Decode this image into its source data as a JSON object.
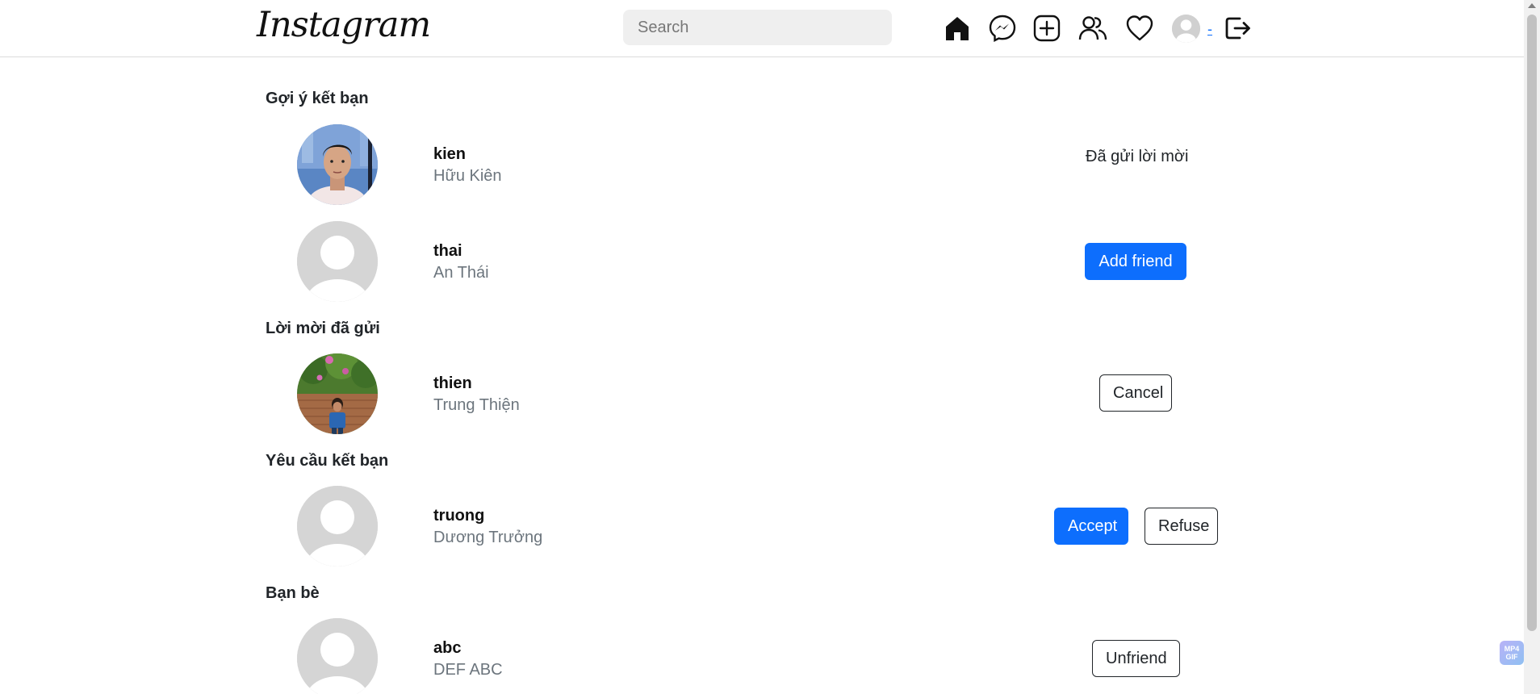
{
  "header": {
    "logo_text": "Instagram",
    "search_placeholder": "Search",
    "username_link": "-",
    "icons": [
      "home-icon",
      "messenger-icon",
      "create-post-icon",
      "friends-icon",
      "heart-icon",
      "avatar",
      "logout-icon"
    ]
  },
  "sections": {
    "suggestions_title": "Gợi ý kết bạn",
    "sent_title": "Lời mời đã gửi",
    "requests_title": "Yêu cầu kết bạn",
    "friends_title": "Bạn bè"
  },
  "suggestions": [
    {
      "username": "kien",
      "full_name": "Hữu Kiên",
      "status": "Đã gửi lời mời"
    },
    {
      "username": "thai",
      "full_name": "An Thái",
      "action": "Add friend"
    }
  ],
  "sent_invites": [
    {
      "username": "thien",
      "full_name": "Trung Thiện",
      "action": "Cancel"
    }
  ],
  "requests": [
    {
      "username": "truong",
      "full_name": "Dương Trưởng",
      "accept": "Accept",
      "refuse": "Refuse"
    }
  ],
  "friends": [
    {
      "username": "abc",
      "full_name": "DEF ABC",
      "action": "Unfriend"
    }
  ],
  "watermark": "MP4 GIF",
  "colors": {
    "primary": "#0d6efd",
    "muted": "#6c757d",
    "placeholder_avatar": "#d5d5d5"
  }
}
